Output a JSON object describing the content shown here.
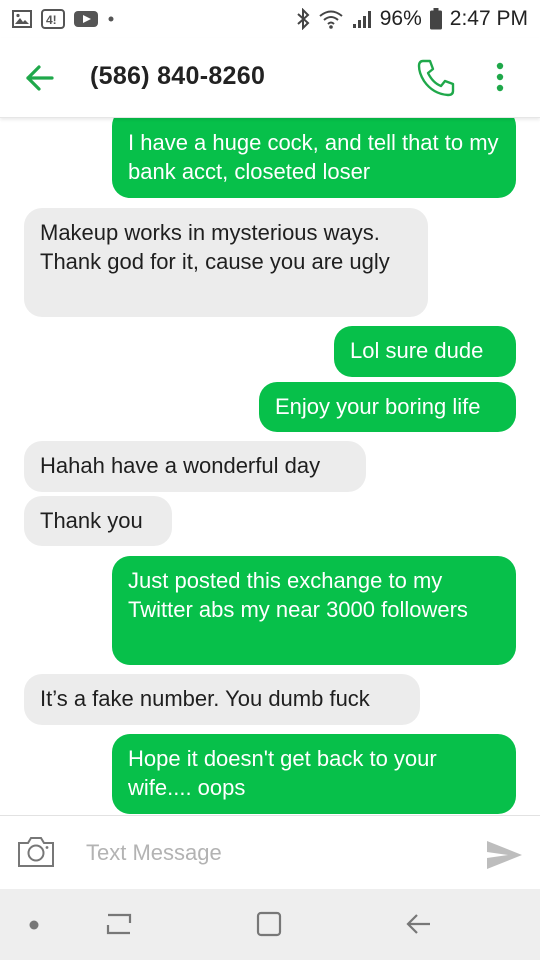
{
  "status_bar": {
    "battery": "96%",
    "time": "2:47 PM",
    "icons": [
      "image-icon",
      "notification-icon",
      "youtube-icon",
      "dot-icon",
      "bluetooth-icon",
      "wifi-icon",
      "signal-icon",
      "battery-icon"
    ]
  },
  "app_bar": {
    "title": "(586) 840-8260",
    "accent": "#1fa84a"
  },
  "messages": [
    {
      "dir": "out",
      "text": "I have a huge cock, and tell that to my bank acct, closeted loser"
    },
    {
      "dir": "in",
      "text": "Makeup works in mysterious ways. Thank god for it, cause you are ugly"
    },
    {
      "dir": "out",
      "text": "Lol sure dude"
    },
    {
      "dir": "out",
      "text": "Enjoy your boring life"
    },
    {
      "dir": "in",
      "text": "Hahah have a wonderful day"
    },
    {
      "dir": "in",
      "text": "Thank you"
    },
    {
      "dir": "out",
      "text": "Just posted this exchange to my Twitter abs my near 3000 followers"
    },
    {
      "dir": "in",
      "text": "It’s a fake number. You dumb fuck"
    },
    {
      "dir": "out",
      "text": "Hope it doesn't get back to your wife.... oops"
    }
  ],
  "composer": {
    "placeholder": "Text Message",
    "value": ""
  },
  "colors": {
    "outgoing_bubble": "#07c04a",
    "incoming_bubble": "#ececec"
  }
}
